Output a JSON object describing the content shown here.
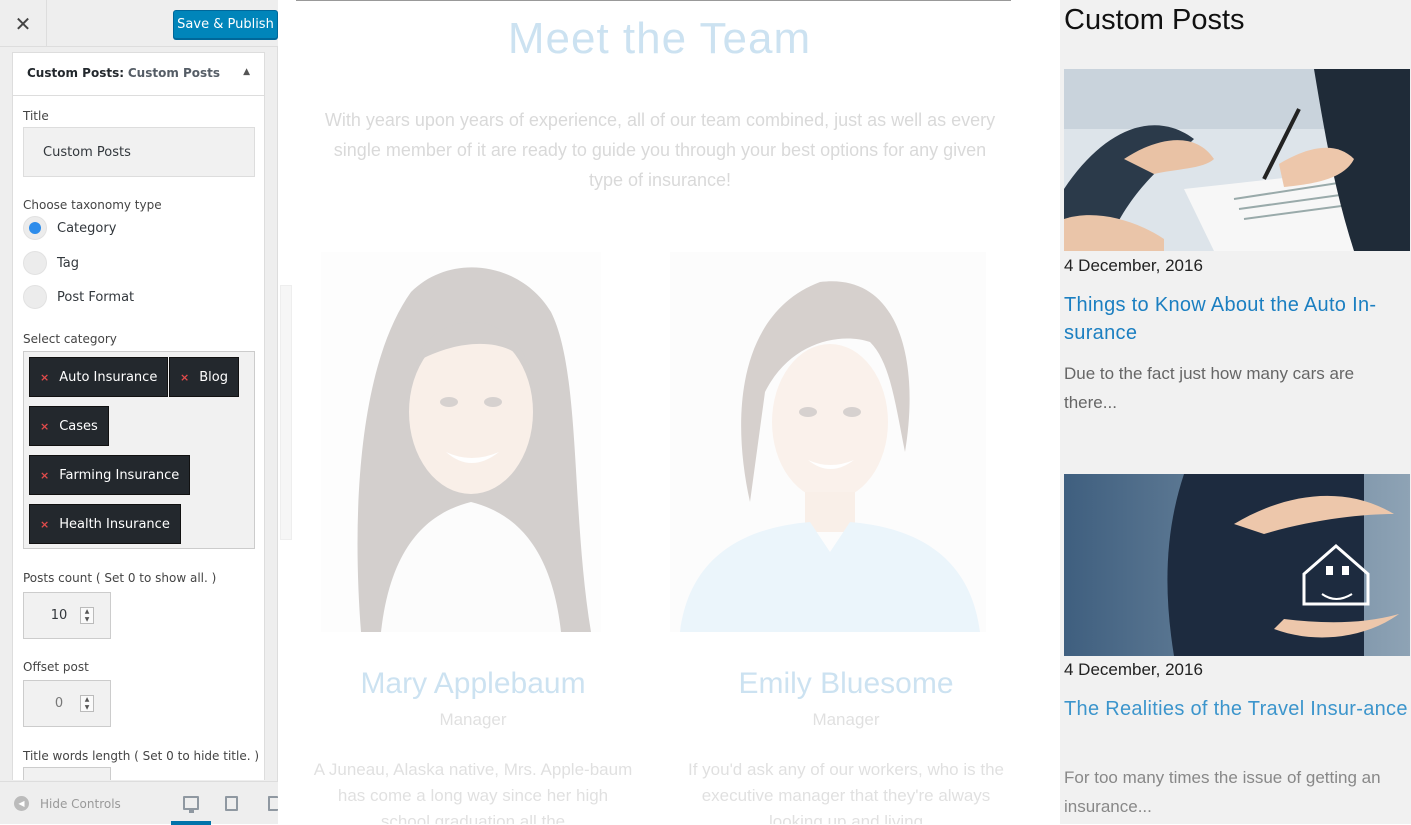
{
  "controls": {
    "close_icon": "close-icon",
    "save_label": "Save & Publish",
    "section": {
      "prefix": "Custom Posts:",
      "name": "Custom Posts"
    },
    "title_label": "Title",
    "title_value": "Custom Posts",
    "taxonomy_label": "Choose taxonomy type",
    "taxonomy_options": [
      {
        "label": "Category",
        "checked": true
      },
      {
        "label": "Tag",
        "checked": false
      },
      {
        "label": "Post Format",
        "checked": false
      }
    ],
    "category_label": "Select category",
    "categories": [
      "Auto Insurance",
      "Blog",
      "Cases",
      "Farming Insurance",
      "Health Insurance"
    ],
    "posts_count_label": "Posts count ( Set 0 to show all. )",
    "posts_count_value": "10",
    "offset_label": "Offset post",
    "offset_value": "0",
    "title_words_label": "Title words length ( Set 0 to hide title. )",
    "footer": {
      "hide_label": "Hide Controls"
    },
    "accent_color": "#0085ba"
  },
  "preview": {
    "team_heading": "Meet the Team",
    "team_intro": "With years upon years of experience, all of our team combined, just as well as every single member of it are ready to guide you through your best options for any given type of insurance!",
    "members": [
      {
        "name": "Mary Applebaum",
        "role": "Manager",
        "bio": "A Juneau, Alaska native, Mrs. Apple-baum has come a long way since her high school graduation all the"
      },
      {
        "name": "Emily Bluesome",
        "role": "Manager",
        "bio": "If you'd ask any of our workers, who is the executive manager that they're always looking up and living"
      }
    ],
    "widget": {
      "title": "Custom Posts",
      "posts": [
        {
          "date": "4 December, 2016",
          "title": "Things to Know About the Auto In-surance",
          "excerpt": "Due to the fact just how many cars are there..."
        },
        {
          "date": "4 December, 2016",
          "title": "The Realities of the Travel Insur-ance",
          "excerpt": "For too many times the issue of getting an insurance..."
        }
      ]
    },
    "link_color": "#1b7fc1"
  }
}
